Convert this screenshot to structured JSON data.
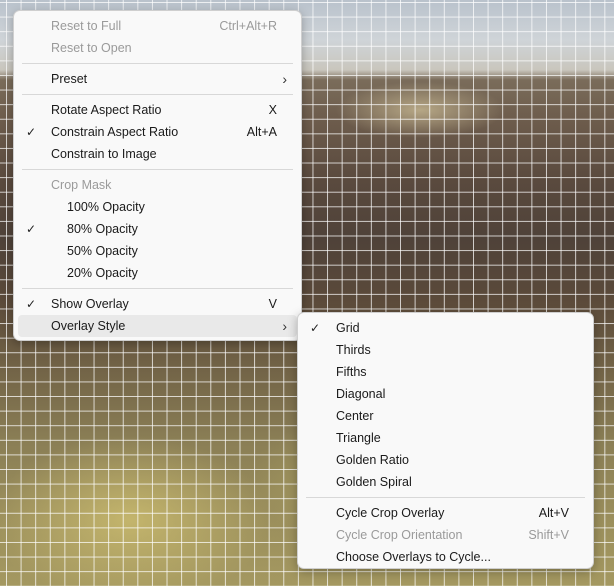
{
  "main_menu": {
    "reset_full": {
      "label": "Reset to Full",
      "shortcut": "Ctrl+Alt+R"
    },
    "reset_open": {
      "label": "Reset to Open"
    },
    "preset": {
      "label": "Preset"
    },
    "rotate_aspect": {
      "label": "Rotate Aspect Ratio",
      "shortcut": "X"
    },
    "constrain_aspect": {
      "label": "Constrain Aspect Ratio",
      "shortcut": "Alt+A",
      "checked": true
    },
    "constrain_image": {
      "label": "Constrain to Image"
    },
    "crop_mask": {
      "label": "Crop Mask"
    },
    "opacity_100": {
      "label": "100% Opacity"
    },
    "opacity_80": {
      "label": "80% Opacity",
      "checked": true
    },
    "opacity_50": {
      "label": "50% Opacity"
    },
    "opacity_20": {
      "label": "20% Opacity"
    },
    "show_overlay": {
      "label": "Show Overlay",
      "shortcut": "V",
      "checked": true
    },
    "overlay_style": {
      "label": "Overlay Style"
    }
  },
  "overlay_submenu": {
    "grid": {
      "label": "Grid",
      "checked": true
    },
    "thirds": {
      "label": "Thirds"
    },
    "fifths": {
      "label": "Fifths"
    },
    "diagonal": {
      "label": "Diagonal"
    },
    "center": {
      "label": "Center"
    },
    "triangle": {
      "label": "Triangle"
    },
    "golden_ratio": {
      "label": "Golden Ratio"
    },
    "golden_spiral": {
      "label": "Golden Spiral"
    },
    "cycle_overlay": {
      "label": "Cycle Crop Overlay",
      "shortcut": "Alt+V"
    },
    "cycle_orientation": {
      "label": "Cycle Crop Orientation",
      "shortcut": "Shift+V"
    },
    "choose_overlays": {
      "label": "Choose Overlays to Cycle..."
    }
  },
  "icons": {
    "check": "✓",
    "submenu_arrow": "›"
  }
}
